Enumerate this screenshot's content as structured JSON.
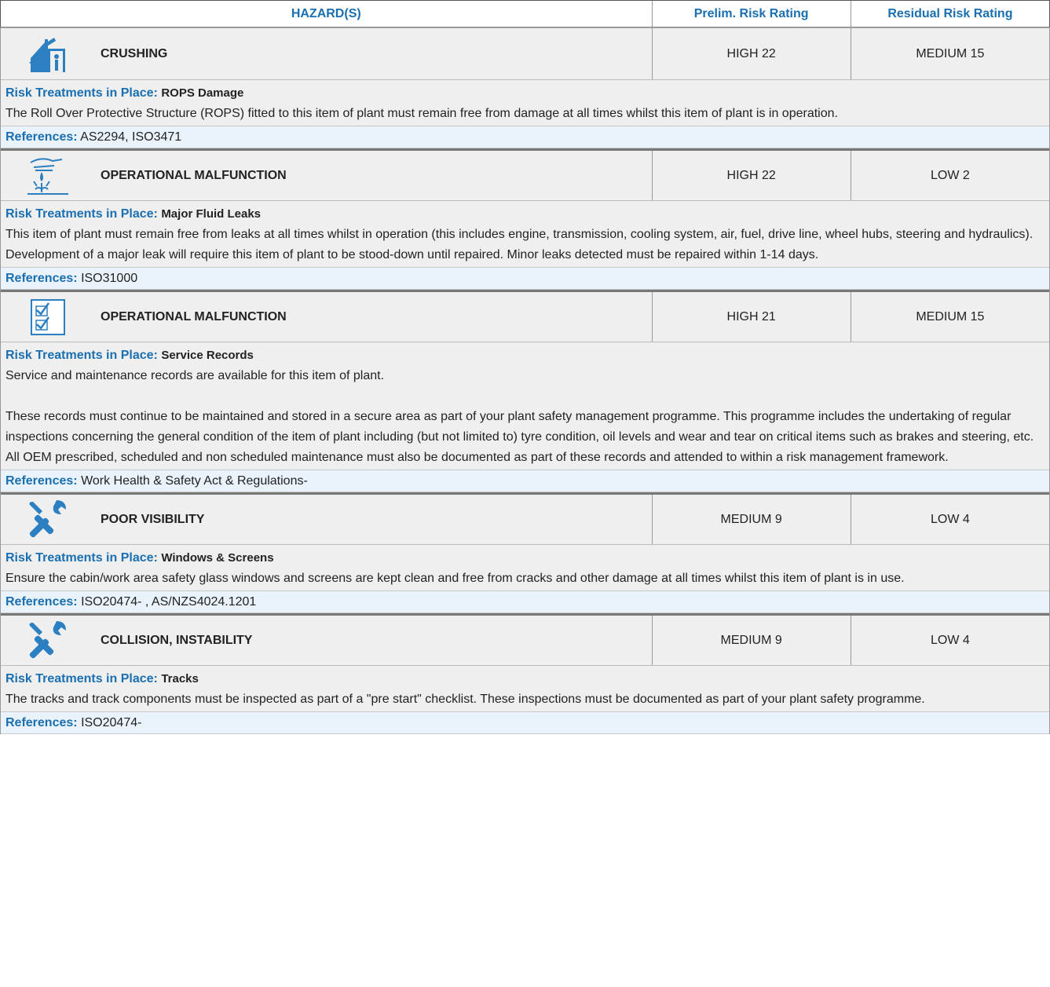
{
  "header": {
    "hazard": "HAZARD(S)",
    "prelim": "Prelim. Risk Rating",
    "residual": "Residual Risk Rating"
  },
  "labels": {
    "treatments": "Risk Treatments in Place:",
    "references": "References:"
  },
  "hazards": [
    {
      "icon": "crushing-icon",
      "name": "CRUSHING",
      "prelim": "HIGH 22",
      "residual": "MEDIUM 15",
      "treatment_name": "ROPS Damage",
      "treatment_text": "The Roll Over Protective Structure (ROPS) fitted to this item of plant must remain free from damage at all times whilst this item of plant is in operation.",
      "references": "AS2294, ISO3471"
    },
    {
      "icon": "fluid-leak-icon",
      "name": "OPERATIONAL MALFUNCTION",
      "prelim": "HIGH 22",
      "residual": "LOW 2",
      "treatment_name": "Major Fluid Leaks",
      "treatment_text": "This item of plant must remain free from leaks at all times whilst in operation (this includes engine, transmission, cooling system, air, fuel, drive line, wheel hubs, steering and hydraulics). Development of a major leak will require this item of plant to be stood-down until repaired. Minor leaks detected must be repaired within 1-14 days.",
      "references": "ISO31000"
    },
    {
      "icon": "checklist-icon",
      "name": "OPERATIONAL MALFUNCTION",
      "prelim": "HIGH 21",
      "residual": "MEDIUM 15",
      "treatment_name": "Service Records",
      "treatment_text": "Service and maintenance records are available for this item of plant.\n\nThese records must continue to be maintained and stored in a secure area as part of your plant safety management programme. This programme includes the undertaking of regular inspections concerning the general condition of the item of plant including (but not limited to) tyre condition, oil levels and wear and tear on critical items such as brakes and steering, etc. All OEM prescribed, scheduled and non scheduled maintenance must also be documented as part of these records and attended to within a risk management framework.",
      "references": "Work Health & Safety Act & Regulations-"
    },
    {
      "icon": "tools-icon",
      "name": "POOR VISIBILITY",
      "prelim": "MEDIUM 9",
      "residual": "LOW 4",
      "treatment_name": "Windows & Screens",
      "treatment_text": "Ensure the cabin/work area safety glass windows and screens are kept clean and free from cracks and other damage at all times whilst this item of plant is in use.",
      "references": "ISO20474- , AS/NZS4024.1201"
    },
    {
      "icon": "tools-icon",
      "name": "COLLISION, INSTABILITY",
      "prelim": "MEDIUM 9",
      "residual": "LOW 4",
      "treatment_name": "Tracks",
      "treatment_text": "The tracks and track components must be inspected as part of a \"pre start\" checklist. These inspections must be documented as part of your plant safety programme.",
      "references": "ISO20474-"
    }
  ]
}
